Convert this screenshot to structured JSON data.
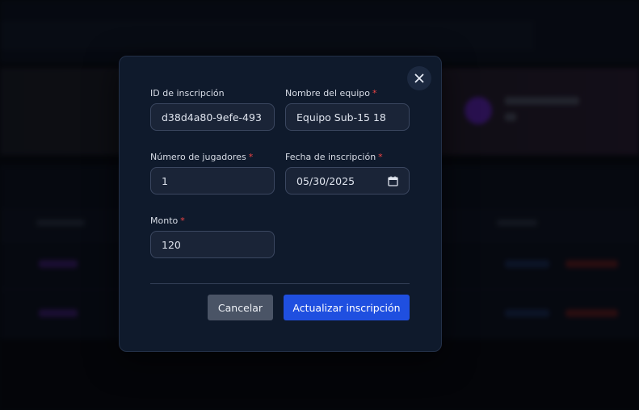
{
  "modal": {
    "close_icon": "close-icon",
    "fields": {
      "registration_id": {
        "label": "ID de inscripción",
        "required": false,
        "value": "d38d4a80-9efe-493"
      },
      "team_name": {
        "label": "Nombre del equipo",
        "required": true,
        "value": "Equipo Sub-15 18"
      },
      "player_count": {
        "label": "Número de jugadores",
        "required": true,
        "value": "1"
      },
      "registration_date": {
        "label": "Fecha de inscripción",
        "required": true,
        "value": "05/30/2025",
        "icon": "calendar-icon"
      },
      "amount": {
        "label": "Monto",
        "required": true,
        "value": "120"
      }
    },
    "required_marker": "*",
    "buttons": {
      "cancel": "Cancelar",
      "update": "Actualizar inscripción"
    }
  },
  "colors": {
    "modal_bg": "#0f1a2c",
    "input_bg": "#1a2437",
    "required": "#ef4444",
    "primary": "#1f4fe0",
    "secondary": "#4a5466"
  }
}
